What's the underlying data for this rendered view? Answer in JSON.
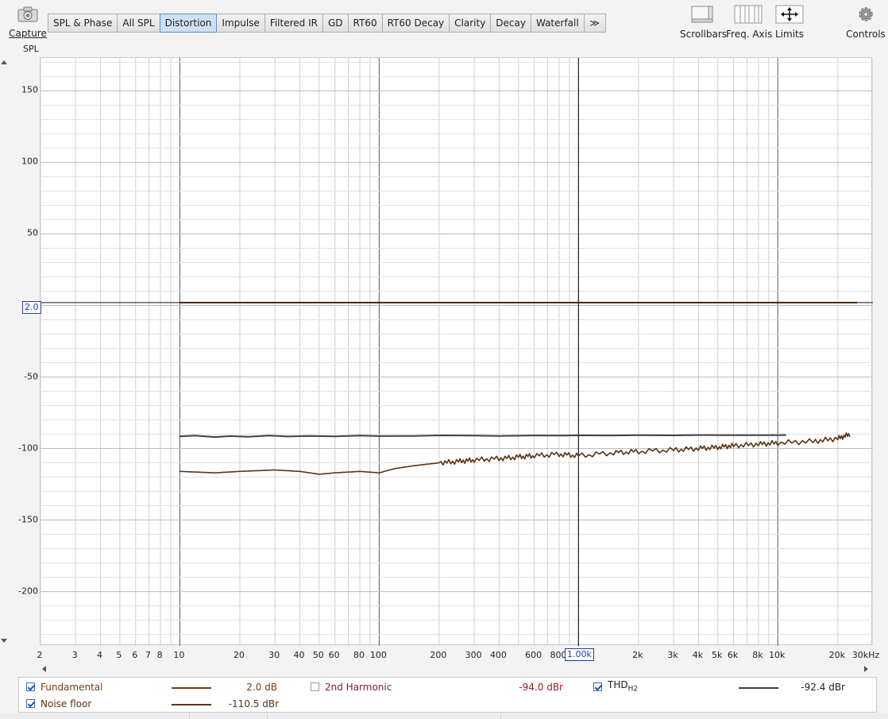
{
  "toolbar": {
    "capture_label": "Capture",
    "tabs": [
      "SPL & Phase",
      "All SPL",
      "Distortion",
      "Impulse",
      "Filtered IR",
      "GD",
      "RT60",
      "RT60 Decay",
      "Clarity",
      "Decay",
      "Waterfall"
    ],
    "active_tab": "Distortion",
    "more_tabs_glyph": "≫",
    "scrollbars_label": "Scrollbars",
    "freq_axis_label": "Freq. Axis",
    "limits_label": "Limits",
    "controls_label": "Controls"
  },
  "plot": {
    "y_axis_label": "SPL",
    "y_cursor_value": "2.0",
    "x_cursor_value": "1.00k",
    "y_tick_labels": [
      "150",
      "100",
      "50",
      "0",
      "-50",
      "-100",
      "-150",
      "-200"
    ],
    "x_tick_labels": [
      "2",
      "3",
      "4",
      "5",
      "6",
      "7",
      "8",
      "10",
      "20",
      "30",
      "40",
      "50",
      "60",
      "80",
      "100",
      "200",
      "300",
      "400",
      "600",
      "800",
      "1.00k",
      "2k",
      "3k",
      "4k",
      "5k",
      "6k",
      "8k",
      "10k",
      "20k",
      "30kHz"
    ]
  },
  "chart_data": {
    "type": "line",
    "x_scale": "log",
    "x_unit": "Hz",
    "y_label": "SPL",
    "xlim": [
      2,
      30000
    ],
    "ylim": [
      -238,
      173
    ],
    "grid": true,
    "cursor": {
      "x": 1000,
      "y": 2.0
    },
    "series": [
      {
        "name": "Fundamental",
        "color": "#7a3d12",
        "x": [
          10,
          25000
        ],
        "y": [
          2,
          2
        ]
      },
      {
        "name": "THD H2",
        "color": "#404040",
        "x": [
          10,
          12,
          15,
          18,
          22,
          28,
          35,
          45,
          60,
          80,
          100,
          150,
          200,
          300,
          400,
          600,
          800,
          1000,
          1500,
          2000,
          3000,
          4000,
          6000,
          8000,
          11000
        ],
        "y": [
          -91.5,
          -91,
          -92,
          -91.3,
          -91.8,
          -91,
          -91.6,
          -91.2,
          -91.5,
          -91,
          -91.3,
          -91.2,
          -90.8,
          -91,
          -91.2,
          -90.9,
          -91,
          -90.8,
          -90.9,
          -90.7,
          -90.8,
          -90.6,
          -90.7,
          -90.7,
          -90.6
        ]
      },
      {
        "name": "Noise floor",
        "color": "#5a3312",
        "x": [
          10,
          15,
          20,
          30,
          40,
          50,
          60,
          80,
          100,
          120,
          150,
          200,
          250,
          300,
          400,
          500,
          600,
          800,
          1000,
          1500,
          2000,
          3000,
          4000,
          5000,
          6000,
          8000,
          10000,
          15000,
          20000,
          23000
        ],
        "y": [
          -116,
          -117,
          -116,
          -115,
          -116,
          -118,
          -117,
          -116,
          -117,
          -114,
          -112,
          -110,
          -109,
          -108,
          -107,
          -106,
          -105,
          -104,
          -105,
          -103,
          -102,
          -101,
          -100,
          -99,
          -98,
          -97,
          -96,
          -95,
          -93,
          -90
        ]
      }
    ]
  },
  "legend": {
    "fundamental": {
      "label": "Fundamental",
      "value": "2.0 dB",
      "checked": true,
      "color": "#7a3d12"
    },
    "second_harmonic": {
      "label": "2nd Harmonic",
      "value": "-94.0 dBr",
      "checked": false
    },
    "thd": {
      "label": "THD",
      "sub": "H2",
      "value": "-92.4 dBr",
      "checked": true,
      "color": "#404040"
    },
    "noise_floor": {
      "label": "Noise floor",
      "value": "-110.5 dBr",
      "checked": true,
      "color": "#5a3312"
    }
  }
}
